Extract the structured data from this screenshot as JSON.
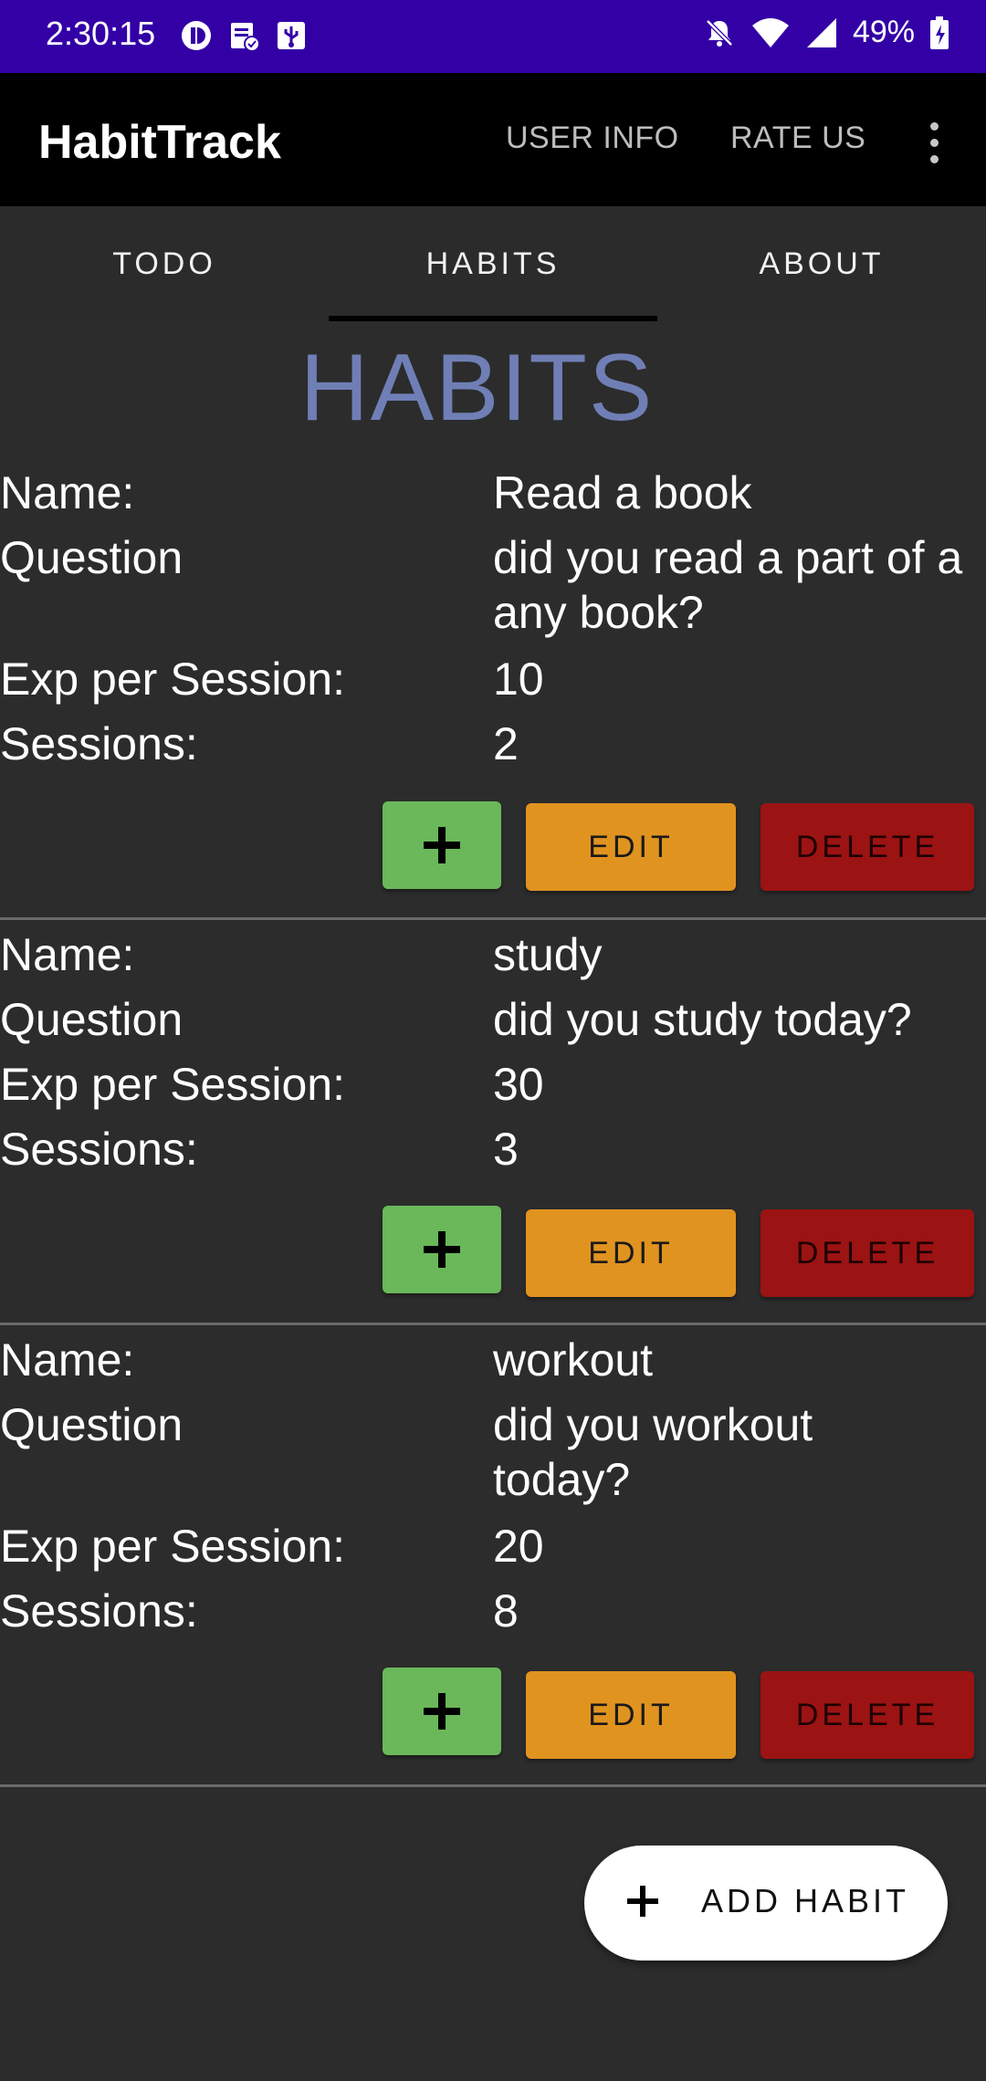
{
  "status_bar": {
    "time": "2:30:15",
    "battery": "49%"
  },
  "app_bar": {
    "title": "HabitTrack",
    "actions": [
      "USER INFO",
      "RATE US"
    ]
  },
  "tabs": [
    {
      "label": "TODO",
      "selected": false
    },
    {
      "label": "HABITS",
      "selected": true
    },
    {
      "label": "ABOUT",
      "selected": false
    }
  ],
  "page_heading": "HABITS",
  "field_labels": {
    "name": "Name:",
    "question": "Question",
    "exp": "Exp per Session:",
    "sessions": "Sessions:"
  },
  "buttons": {
    "edit": "EDIT",
    "delete": "DELETE"
  },
  "habits": [
    {
      "name": "Read a book",
      "question": "did you read a part of a any book?",
      "exp": "10",
      "sessions": "2"
    },
    {
      "name": "study",
      "question": "did you study today?",
      "exp": "30",
      "sessions": "3"
    },
    {
      "name": "workout",
      "question": "did you workout today?",
      "exp": "20",
      "sessions": "8"
    }
  ],
  "fab": {
    "label": "ADD HABIT"
  },
  "colors": {
    "status_bar": "#3300a6",
    "background": "#2c2c2c",
    "heading": "#6f7fb6",
    "plus_button": "#6ab85a",
    "edit_button": "#e19320",
    "delete_button": "#9b1313"
  }
}
